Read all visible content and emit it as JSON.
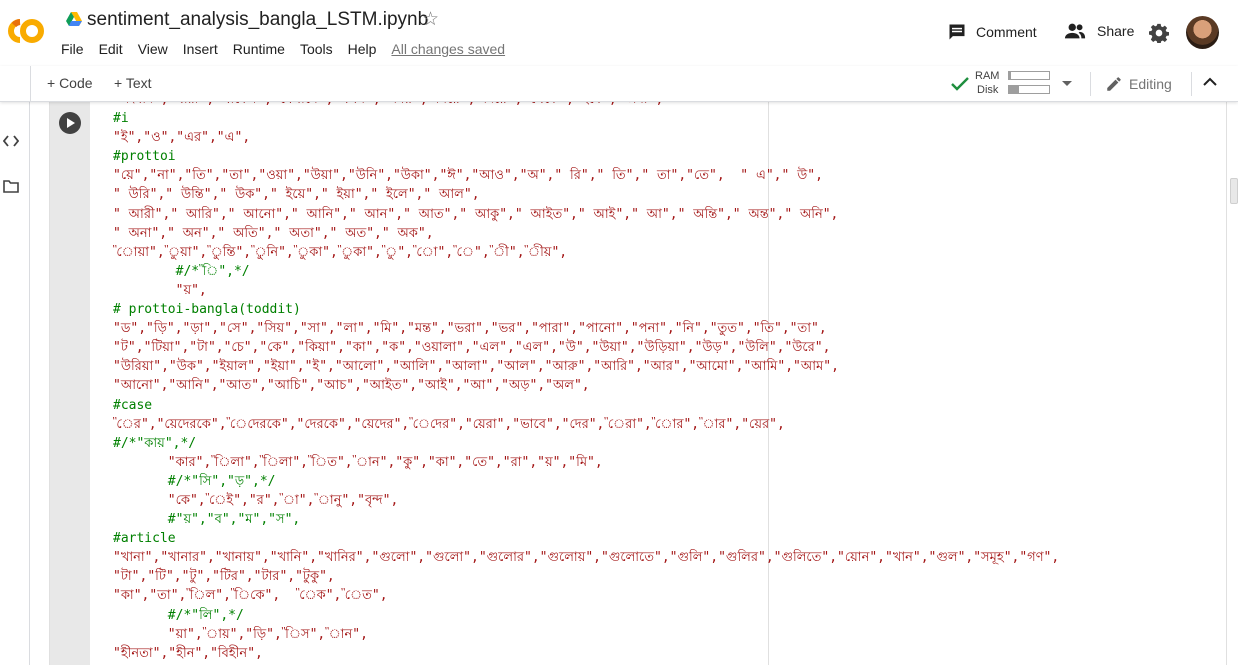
{
  "notebook": {
    "title": "sentiment_analysis_bangla_LSTM.ipynb",
    "menu": [
      "File",
      "Edit",
      "View",
      "Insert",
      "Runtime",
      "Tools",
      "Help"
    ],
    "save_status": "All changes saved"
  },
  "header": {
    "comment_label": "Comment",
    "share_label": "Share",
    "icons": [
      "colab-logo",
      "drive-icon",
      "star-icon",
      "comment-icon",
      "share-icon",
      "gear-icon",
      "avatar"
    ]
  },
  "toolbar": {
    "add_code_label": "+ Code",
    "add_text_label": "+ Text",
    "ram_label": "RAM",
    "disk_label": "Disk",
    "ram_usage": 0.05,
    "disk_usage": 0.25,
    "editing_label": "Editing"
  },
  "colors": {
    "string": "#a31515",
    "comment": "#008000",
    "accent_check": "#1e8e3e"
  },
  "code_lines": [
    {
      "type": "str",
      "text": "\"সংবাদ\",\"যারা\",\"থাকেন\",\"যেখানে\",\"যখন\",\"সময়\",\"নিয়ে\",\"দিয়ে\",\"থেকে\",\"হবে\",\"জন্য\","
    },
    {
      "type": "cm",
      "text": "#i"
    },
    {
      "type": "str",
      "text": "\"ই\",\"ও\",\"এর\",\"এ\","
    },
    {
      "type": "cm",
      "text": "#prottoi"
    },
    {
      "type": "str",
      "text": "\"য়ে\",\"না\",\"তি\",\"তা\",\"ওয়া\",\"উয়া\",\"উনি\",\"উকা\",\"ঈ\",\"আও\",\"অ\",\" রি\",\" তি\",\" তা\",\"তে\",  \" এ\",\" উ\","
    },
    {
      "type": "str",
      "text": "\" উরি\",\" উন্তি\",\" উক\",\" ইয়ে\",\" ইয়া\",\" ইলে\",\" আল\","
    },
    {
      "type": "str",
      "text": "\" আরী\",\" আরি\",\" আনো\",\" আনি\",\" আন\",\" আত\",\" আকু\",\" আইত\",\" আই\",\" আ\",\" অন্তি\",\" অন্ত\",\" অনি\","
    },
    {
      "type": "str",
      "text": "\" অনা\",\" অন\",\" অতি\",\" অতা\",\" অত\",\" অক\","
    },
    {
      "type": "str",
      "text": "\"োয়া\",\"ুয়া\",\"ুন্তি\",\"ুনি\",\"ুকা\",\"ুকা\",\"ু\",\"ো\",\"ে\",\"ী\",\"ীয়\","
    },
    {
      "type": "cm",
      "text": "        #/*\"ি\",*/"
    },
    {
      "type": "str",
      "text": "        \"য়\","
    },
    {
      "type": "cm",
      "text": "# prottoi-bangla(toddit)"
    },
    {
      "type": "str",
      "text": "\"ড\",\"ড়ি\",\"ড়া\",\"সে\",\"সিয়\",\"সা\",\"লা\",\"মি\",\"মন্ত\",\"ভরা\",\"ভর\",\"পারা\",\"পানো\",\"পনা\",\"নি\",\"তুত\",\"তি\",\"তা\","
    },
    {
      "type": "str",
      "text": "\"ট\",\"টিয়া\",\"টা\",\"চে\",\"কে\",\"কিয়া\",\"কা\",\"ক\",\"ওয়ালা\",\"এল\",\"এল\",\"উ\",\"উয়া\",\"উড়িয়া\",\"উড়\",\"উলি\",\"উরে\","
    },
    {
      "type": "str",
      "text": "\"উরিয়া\",\"উক\",\"ইয়াল\",\"ইয়া\",\"ই\",\"আলো\",\"আলি\",\"আলা\",\"আল\",\"আরু\",\"আরি\",\"আর\",\"আমো\",\"আমি\",\"আম\","
    },
    {
      "type": "str",
      "text": "\"আনো\",\"আনি\",\"আত\",\"আচি\",\"আচ\",\"আইত\",\"আই\",\"আ\",\"অড়\",\"অল\","
    },
    {
      "type": "cm",
      "text": "#case"
    },
    {
      "type": "str",
      "text": "\"ের\",\"য়েদেরকে\",\"েদেরকে\",\"দেরকে\",\"য়েদের\",\"েদের\",\"য়েরা\",\"ভাবে\",\"দের\",\"েরা\",\"োর\",\"ার\",\"য়ের\","
    },
    {
      "type": "cm",
      "text": "#/*\"কায়\",*/"
    },
    {
      "type": "str",
      "text": "       \"কার\",\"িলা\",\"িলা\",\"িত\",\"ান\",\"কু\",\"কা\",\"তে\",\"রা\",\"য়\",\"মি\","
    },
    {
      "type": "cm",
      "text": "       #/*\"সি\",\"ড়\",*/"
    },
    {
      "type": "str",
      "text": "       \"কে\",\"েই\",\"র\",\"া\",\"ানু\",\"বৃন্দ\","
    },
    {
      "type": "cm",
      "text": "       #\"য়\",\"ব\",\"ম\",\"স\","
    },
    {
      "type": "cm",
      "text": "#article"
    },
    {
      "type": "str",
      "text": "\"খানা\",\"খানার\",\"খানায়\",\"খানি\",\"খানির\",\"গুলো\",\"গুলো\",\"গুলোর\",\"গুলোয়\",\"গুলোতে\",\"গুলি\",\"গুলির\",\"গুলিতে\",\"য়োন\",\"খান\",\"গুল\",\"সমূহ\",\"গণ\","
    },
    {
      "type": "str",
      "text": "\"টা\",\"টি\",\"টু\",\"টির\",\"টার\",\"টুকু\","
    },
    {
      "type": "str",
      "text": "\"কা\",\"তা\",\"িল\",\"িকে\",  \"েক\",\"েত\","
    },
    {
      "type": "cm",
      "text": "       #/*\"লি\",*/"
    },
    {
      "type": "str",
      "text": "       \"য়া\",\"ায়\",\"ড়ি\",\"িস\",\"ান\","
    },
    {
      "type": "str",
      "text": "\"হীনতা\",\"হীন\",\"বিহীন\","
    }
  ]
}
